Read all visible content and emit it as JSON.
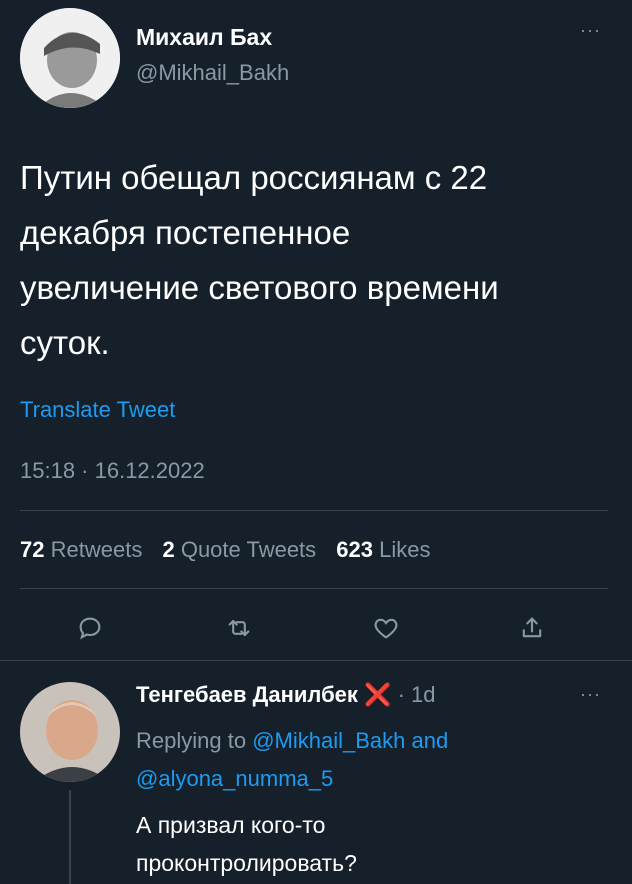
{
  "tweet": {
    "author_name": "Михаил Бах",
    "author_handle": "@Mikhail_Bakh",
    "text_lines": [
      "Путин обещал россиянам с 22",
      "декабря постепенное",
      "увеличение светового времени",
      "суток."
    ],
    "translate_label": "Translate Tweet",
    "timestamp": "15:18 · 16.12.2022",
    "stats": {
      "retweets_count": "72",
      "retweets_label": "Retweets",
      "quotes_count": "2",
      "quotes_label": "Quote Tweets",
      "likes_count": "623",
      "likes_label": "Likes"
    },
    "more_label": "···"
  },
  "actions": [
    "reply-icon",
    "retweet-icon",
    "like-icon",
    "share-icon"
  ],
  "reply": {
    "author_name": "Тенгебаев Данилбек",
    "badge": "❌",
    "time": "· 1d",
    "replying_prefix": "Replying to",
    "mention_1": "@Mikhail_Bakh",
    "and_label": "and",
    "mention_2": "@alyona_numma_5",
    "text_lines": [
      "А призвал кого-то",
      "проконтролировать?"
    ],
    "more_label": "···"
  },
  "colors": {
    "background": "#15202b",
    "accent": "#1d9bf0",
    "muted": "#8b98a5",
    "divider": "#38444d",
    "badge_red": "#e0245e"
  }
}
